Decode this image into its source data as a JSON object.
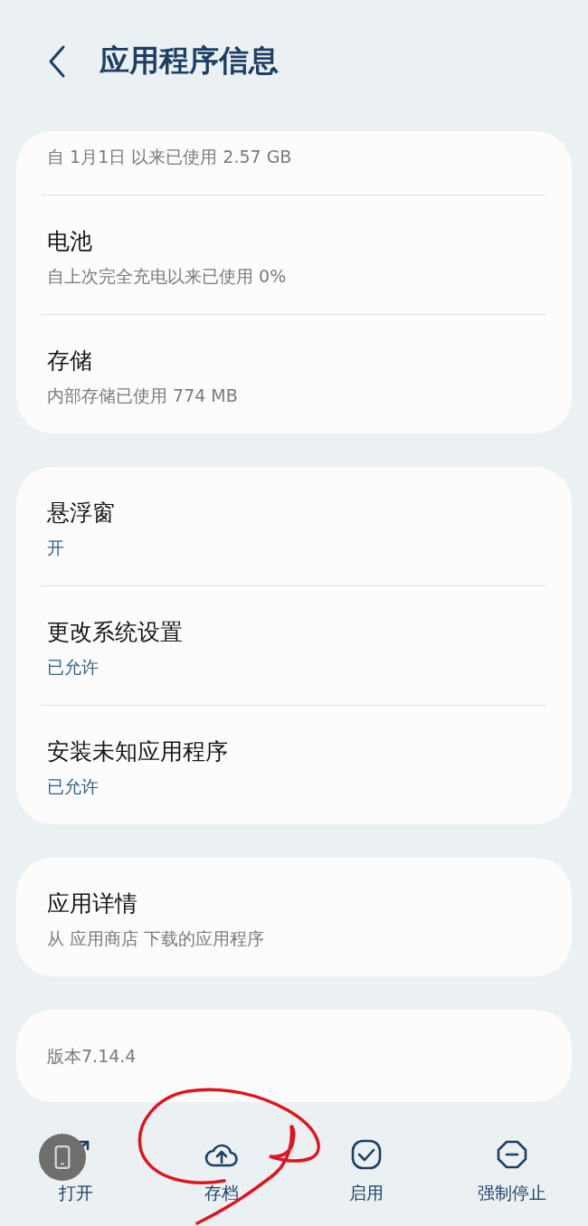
{
  "header": {
    "title": "应用程序信息"
  },
  "sections": [
    {
      "items": [
        {
          "subtitle": "自 1月1日 以来已使用 2.57 GB",
          "kind": "info"
        },
        {
          "title": "电池",
          "subtitle": "自上次完全充电以来已使用 0%",
          "kind": "info"
        },
        {
          "title": "存储",
          "subtitle": "内部存储已使用 774 MB",
          "kind": "info"
        }
      ]
    },
    {
      "items": [
        {
          "title": "悬浮窗",
          "subtitle": "开",
          "kind": "status"
        },
        {
          "title": "更改系统设置",
          "subtitle": "已允许",
          "kind": "status"
        },
        {
          "title": "安装未知应用程序",
          "subtitle": "已允许",
          "kind": "status"
        }
      ]
    },
    {
      "items": [
        {
          "title": "应用详情",
          "subtitle": "从 应用商店 下载的应用程序",
          "kind": "info"
        }
      ]
    },
    {
      "items": [
        {
          "subtitle": "版本7.14.4",
          "kind": "info"
        }
      ]
    }
  ],
  "actions": [
    {
      "label": "打开",
      "kind": "open"
    },
    {
      "label": "存档",
      "kind": "upload"
    },
    {
      "label": "启用",
      "kind": "check"
    },
    {
      "label": "强制停止",
      "kind": "stop"
    }
  ],
  "floating_button": {
    "kind": "phone"
  },
  "annotation": {
    "kind": "freehand-circle"
  }
}
